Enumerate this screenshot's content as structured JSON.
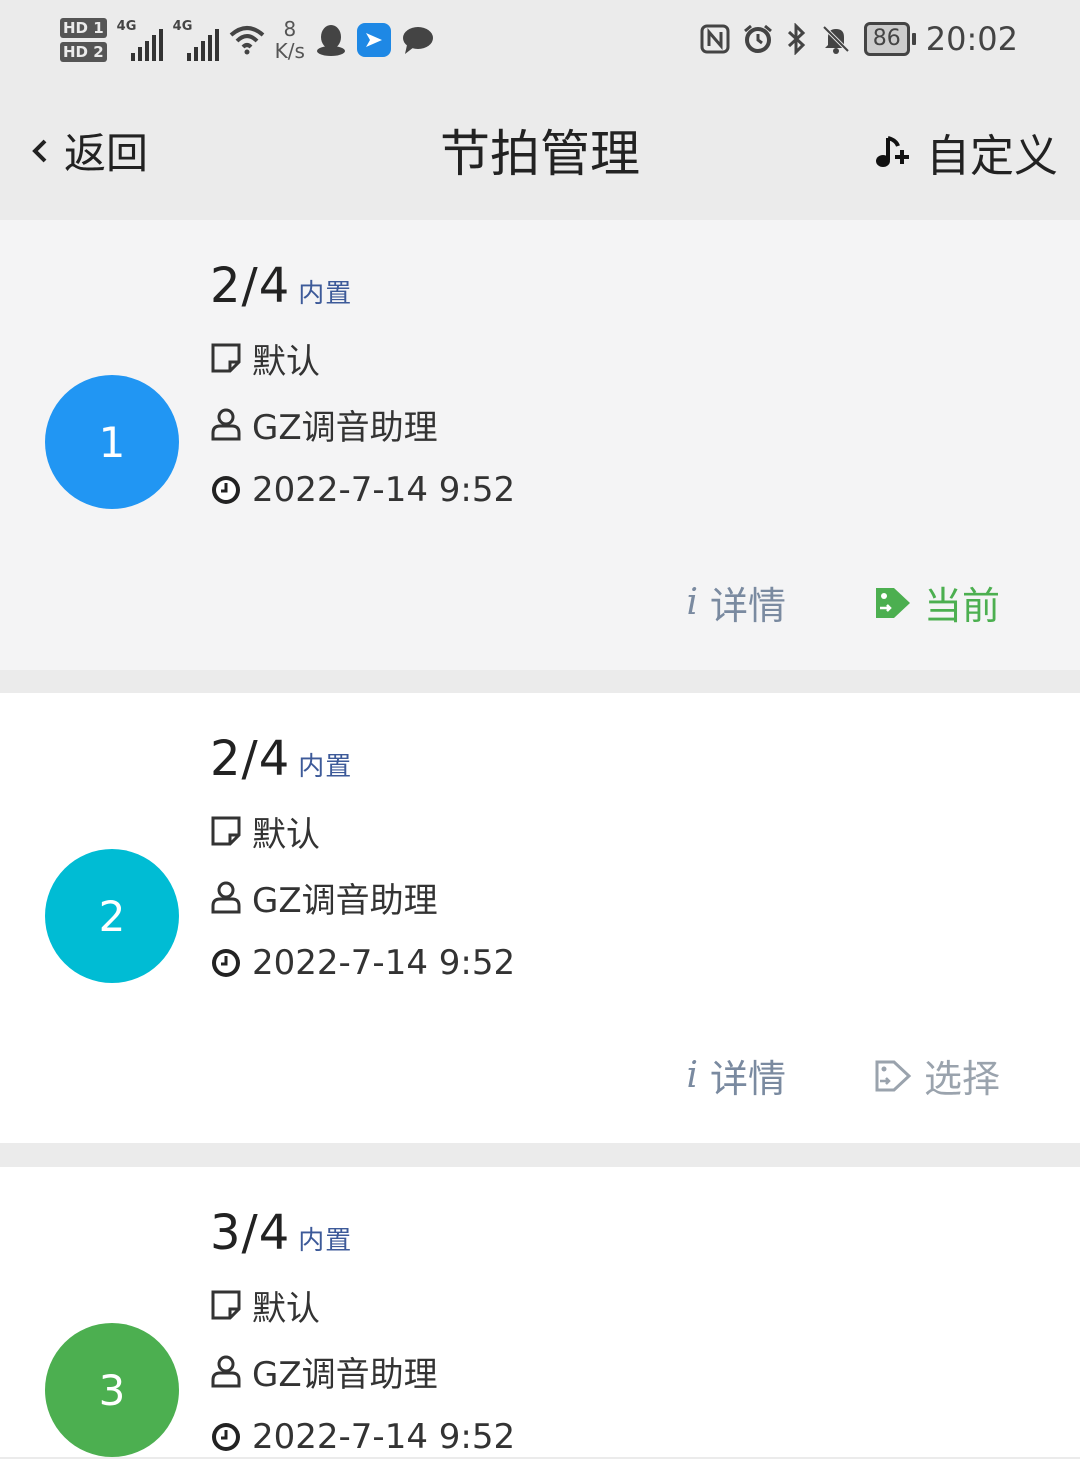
{
  "status_bar": {
    "sim1": "HD 1",
    "sim2": "HD 2",
    "net1": "4G",
    "net2": "4G",
    "speed_value": "8",
    "speed_unit": "K/s",
    "battery": "86",
    "time": "20:02",
    "icons": [
      "qq-icon",
      "feishu-icon",
      "chat-icon",
      "nfc-icon",
      "alarm-icon",
      "bluetooth-icon",
      "mute-icon"
    ]
  },
  "header": {
    "back_label": "返回",
    "title": "节拍管理",
    "custom_label": "自定义"
  },
  "colors": {
    "circle1": "#2196f3",
    "circle2": "#00bcd4",
    "circle3": "#4caf50",
    "accent_green": "#4caf50",
    "builtin_blue": "#3d5a99"
  },
  "items": [
    {
      "index": "1",
      "beat": "2/4",
      "tag": "内置",
      "category": "默认",
      "author": "GZ调音助理",
      "time": "2022-7-14 9:52",
      "detail_label": "详情",
      "status_label": "当前"
    },
    {
      "index": "2",
      "beat": "2/4",
      "tag": "内置",
      "category": "默认",
      "author": "GZ调音助理",
      "time": "2022-7-14 9:52",
      "detail_label": "详情",
      "status_label": "选择"
    },
    {
      "index": "3",
      "beat": "3/4",
      "tag": "内置",
      "category": "默认",
      "author": "GZ调音助理",
      "time": "2022-7-14 9:52"
    }
  ]
}
